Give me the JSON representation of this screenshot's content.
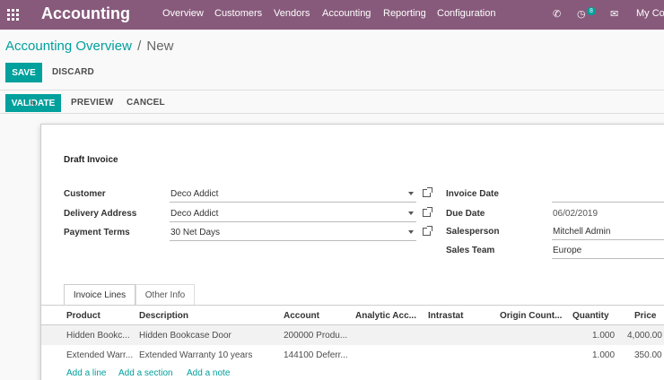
{
  "app": {
    "title": "Accounting"
  },
  "navbar": {
    "menus": [
      "Overview",
      "Customers",
      "Vendors",
      "Accounting",
      "Reporting",
      "Configuration"
    ],
    "badge_count": "8",
    "user_label": "My Co"
  },
  "breadcrumb": {
    "parent": "Accounting Overview",
    "separator": "/",
    "current": "New"
  },
  "buttons": {
    "save": "SAVE",
    "discard": "DISCARD",
    "validate": "VALIDATE",
    "preview": "PREVIEW",
    "cancel": "CANCEL"
  },
  "form": {
    "title": "Draft Invoice",
    "customer_label": "Customer",
    "customer_value": "Deco Addict",
    "delivery_label": "Delivery Address",
    "delivery_value": "Deco Addict",
    "payment_terms_label": "Payment Terms",
    "payment_terms_value": "30 Net Days",
    "invoice_date_label": "Invoice Date",
    "invoice_date_value": "",
    "due_date_label": "Due Date",
    "due_date_value": "06/02/2019",
    "salesperson_label": "Salesperson",
    "salesperson_value": "Mitchell Admin",
    "sales_team_label": "Sales Team",
    "sales_team_value": "Europe"
  },
  "tabs": [
    "Invoice Lines",
    "Other Info"
  ],
  "table": {
    "headers": [
      "Product",
      "Description",
      "Account",
      "Analytic Acc...",
      "Intrastat",
      "Origin Count...",
      "Quantity",
      "Price"
    ],
    "rows": [
      [
        "Hidden Bookc...",
        "Hidden Bookcase Door",
        "200000 Produ...",
        "",
        "",
        "",
        "1.000",
        "4,000.00"
      ],
      [
        "Extended Warr...",
        "Extended Warranty 10 years",
        "144100 Deferr...",
        "",
        "",
        "",
        "1.000",
        "350.00"
      ]
    ],
    "add_line": "Add a line",
    "add_section": "Add a section",
    "add_note": "Add a note"
  },
  "colors": {
    "navbar": "#875a7b",
    "accent": "#00a09d"
  }
}
